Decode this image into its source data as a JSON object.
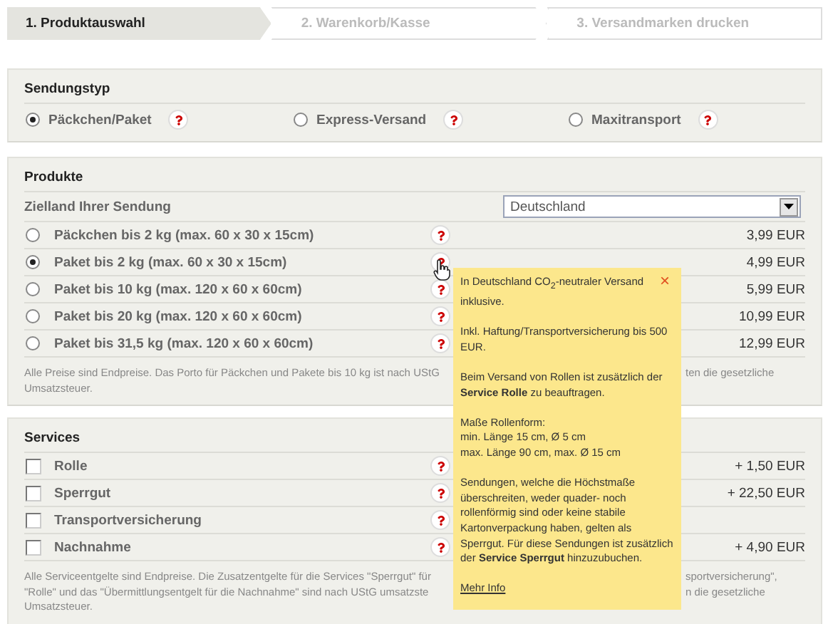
{
  "steps": [
    {
      "label": "1. Produktauswahl",
      "selected": true
    },
    {
      "label": "2. Warenkorb/Kasse",
      "selected": false
    },
    {
      "label": "3. Versandmarken drucken",
      "selected": false
    }
  ],
  "shipment_type": {
    "title": "Sendungstyp",
    "options": [
      {
        "label": "Päckchen/Paket",
        "selected": true
      },
      {
        "label": "Express-Versand",
        "selected": false
      },
      {
        "label": "Maxitransport",
        "selected": false
      }
    ]
  },
  "products": {
    "title": "Produkte",
    "destination": {
      "label": "Zielland Ihrer Sendung",
      "value": "Deutschland"
    },
    "items": [
      {
        "label": "Päckchen bis 2 kg (max. 60 x 30 x 15cm)",
        "price": "3,99 EUR",
        "selected": false
      },
      {
        "label": "Paket bis 2 kg (max. 60 x 30 x 15cm)",
        "price": "4,99 EUR",
        "selected": true
      },
      {
        "label": "Paket bis 10 kg (max. 120 x 60 x 60cm)",
        "price": "5,99 EUR",
        "selected": false
      },
      {
        "label": "Paket bis 20 kg (max. 120 x 60 x 60cm)",
        "price": "10,99 EUR",
        "selected": false
      },
      {
        "label": "Paket bis 31,5 kg (max. 120 x 60 x 60cm)",
        "price": "12,99 EUR",
        "selected": false
      }
    ],
    "note": {
      "left": [
        "Alle Preise sind Endpreise. Das Porto für Päckchen und Pakete bis 10 kg ist nach UStG",
        "Umsatzsteuer."
      ],
      "right": [
        "ten die gesetzliche"
      ]
    }
  },
  "services": {
    "title": "Services",
    "items": [
      {
        "label": "Rolle",
        "price": "+ 1,50 EUR",
        "checked": false
      },
      {
        "label": "Sperrgut",
        "price": "+ 22,50 EUR",
        "checked": false
      },
      {
        "label": "Transportversicherung",
        "checked": false
      },
      {
        "label": "Nachnahme",
        "price": "+ 4,90 EUR",
        "checked": false
      }
    ],
    "note": {
      "left": [
        "Alle Serviceentgelte sind Endpreise. Die Zusatzentgelte für die Services \"Sperrgut\" für",
        "\"Rolle\" und das \"Übermittlungsentgelt für die Nachnahme\" sind nach UStG umsatzste",
        "Umsatzsteuer."
      ],
      "right": [
        "sportversicherung\",",
        "n die gesetzliche"
      ]
    }
  },
  "tooltip": {
    "close": "×",
    "paragraphs": [
      [
        "In Deutschland CO$_{2}$-neutraler Versand inklusive."
      ],
      [
        "Inkl. Haftung/Transportversicherung bis 500 EUR."
      ],
      [
        "Beim Versand von Rollen ist zusätzlich der **Service Rolle** zu beauftragen."
      ],
      [
        "Maße Rollenform:",
        "min. Länge 15 cm, Ø 5 cm",
        "max. Länge 90 cm, max. Ø 15 cm"
      ],
      [
        "Sendungen, welche die Höchstmaße überschreiten, weder quader- noch rollenförmig sind oder keine stabile Kartonverpackung haben, gelten als Sperrgut. Für diese Sendungen ist zusätzlich der **Service Sperrgut** hinzuzubuchen."
      ]
    ],
    "link": "Mehr Info"
  }
}
